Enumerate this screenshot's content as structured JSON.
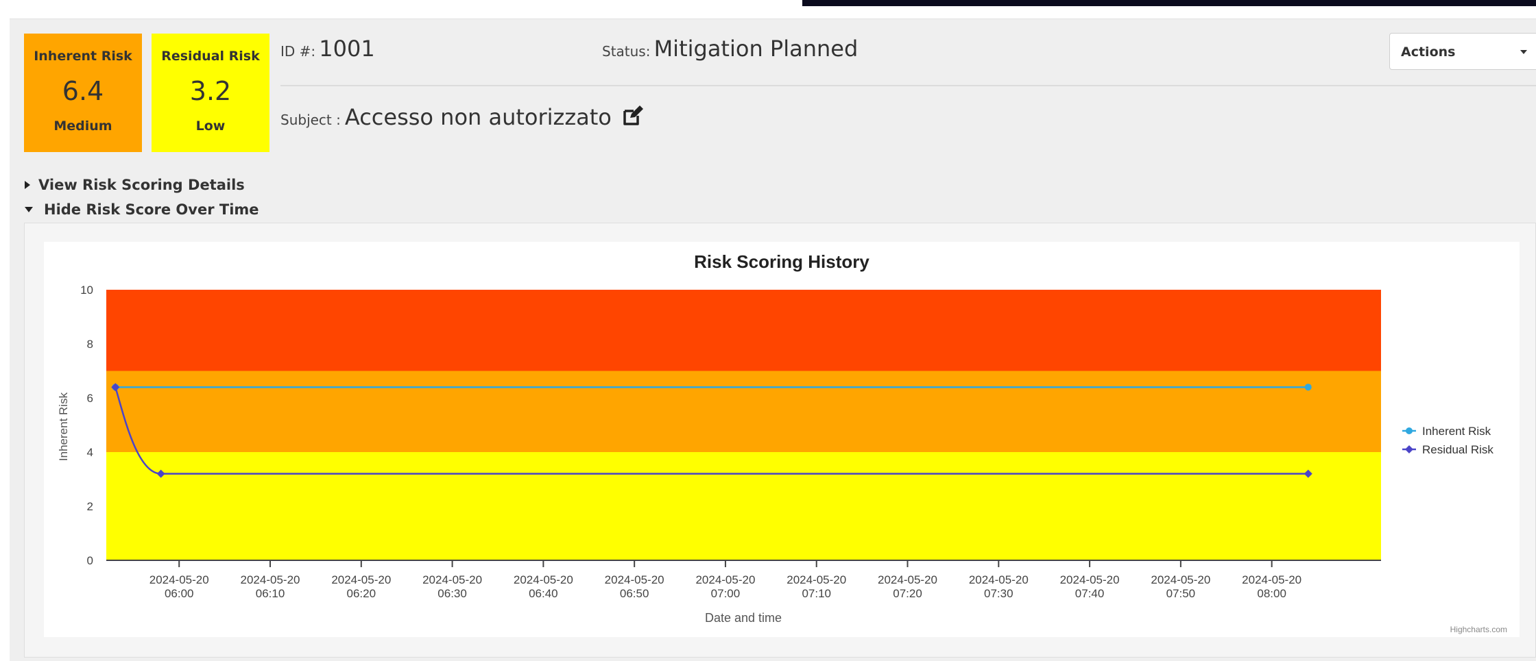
{
  "inherent": {
    "label": "Inherent Risk",
    "score": "6.4",
    "level": "Medium",
    "color": "#ffa500"
  },
  "residual": {
    "label": "Residual Risk",
    "score": "3.2",
    "level": "Low",
    "color": "#ffff00"
  },
  "record": {
    "id_label": "ID #:",
    "id_value": "1001",
    "status_label": "Status:",
    "status_value": "Mitigation Planned",
    "subject_label": "Subject :",
    "subject_value": "Accesso non autorizzato"
  },
  "actions": {
    "label": "Actions"
  },
  "toggles": {
    "details": "View Risk Scoring Details",
    "history": "Hide Risk Score Over Time"
  },
  "icons": {
    "edit": "edit-square-icon",
    "collapsed": "caret-right-icon",
    "expanded": "caret-down-icon"
  },
  "chart_data": {
    "type": "line",
    "title": "Risk Scoring History",
    "xlabel": "Date and time",
    "ylabel": "Inherent Risk",
    "ylim": [
      0,
      10
    ],
    "yticks": [
      "0",
      "2",
      "4",
      "6",
      "8",
      "10"
    ],
    "xticks": [
      [
        "2024-05-20",
        "06:00"
      ],
      [
        "2024-05-20",
        "06:10"
      ],
      [
        "2024-05-20",
        "06:20"
      ],
      [
        "2024-05-20",
        "06:30"
      ],
      [
        "2024-05-20",
        "06:40"
      ],
      [
        "2024-05-20",
        "06:50"
      ],
      [
        "2024-05-20",
        "07:00"
      ],
      [
        "2024-05-20",
        "07:10"
      ],
      [
        "2024-05-20",
        "07:20"
      ],
      [
        "2024-05-20",
        "07:30"
      ],
      [
        "2024-05-20",
        "07:40"
      ],
      [
        "2024-05-20",
        "07:50"
      ],
      [
        "2024-05-20",
        "08:00"
      ]
    ],
    "xrange": [
      "2024-05-20 05:52",
      "2024-05-20 08:12"
    ],
    "bands": [
      {
        "from": 0,
        "to": 4,
        "color": "#ffff00"
      },
      {
        "from": 4,
        "to": 7,
        "color": "#ffa500"
      },
      {
        "from": 7,
        "to": 10,
        "color": "#ff4500"
      }
    ],
    "series": [
      {
        "name": "Inherent Risk",
        "color": "#2fa8e0",
        "marker": "circle",
        "points": [
          [
            "2024-05-20 05:53",
            6.4
          ],
          [
            "2024-05-20 08:04",
            6.4
          ]
        ]
      },
      {
        "name": "Residual Risk",
        "color": "#4b44c8",
        "marker": "diamond",
        "points": [
          [
            "2024-05-20 05:53",
            6.4
          ],
          [
            "2024-05-20 05:58",
            3.2
          ],
          [
            "2024-05-20 08:04",
            3.2
          ]
        ]
      }
    ],
    "legend_position": "right",
    "credits": "Highcharts.com"
  }
}
